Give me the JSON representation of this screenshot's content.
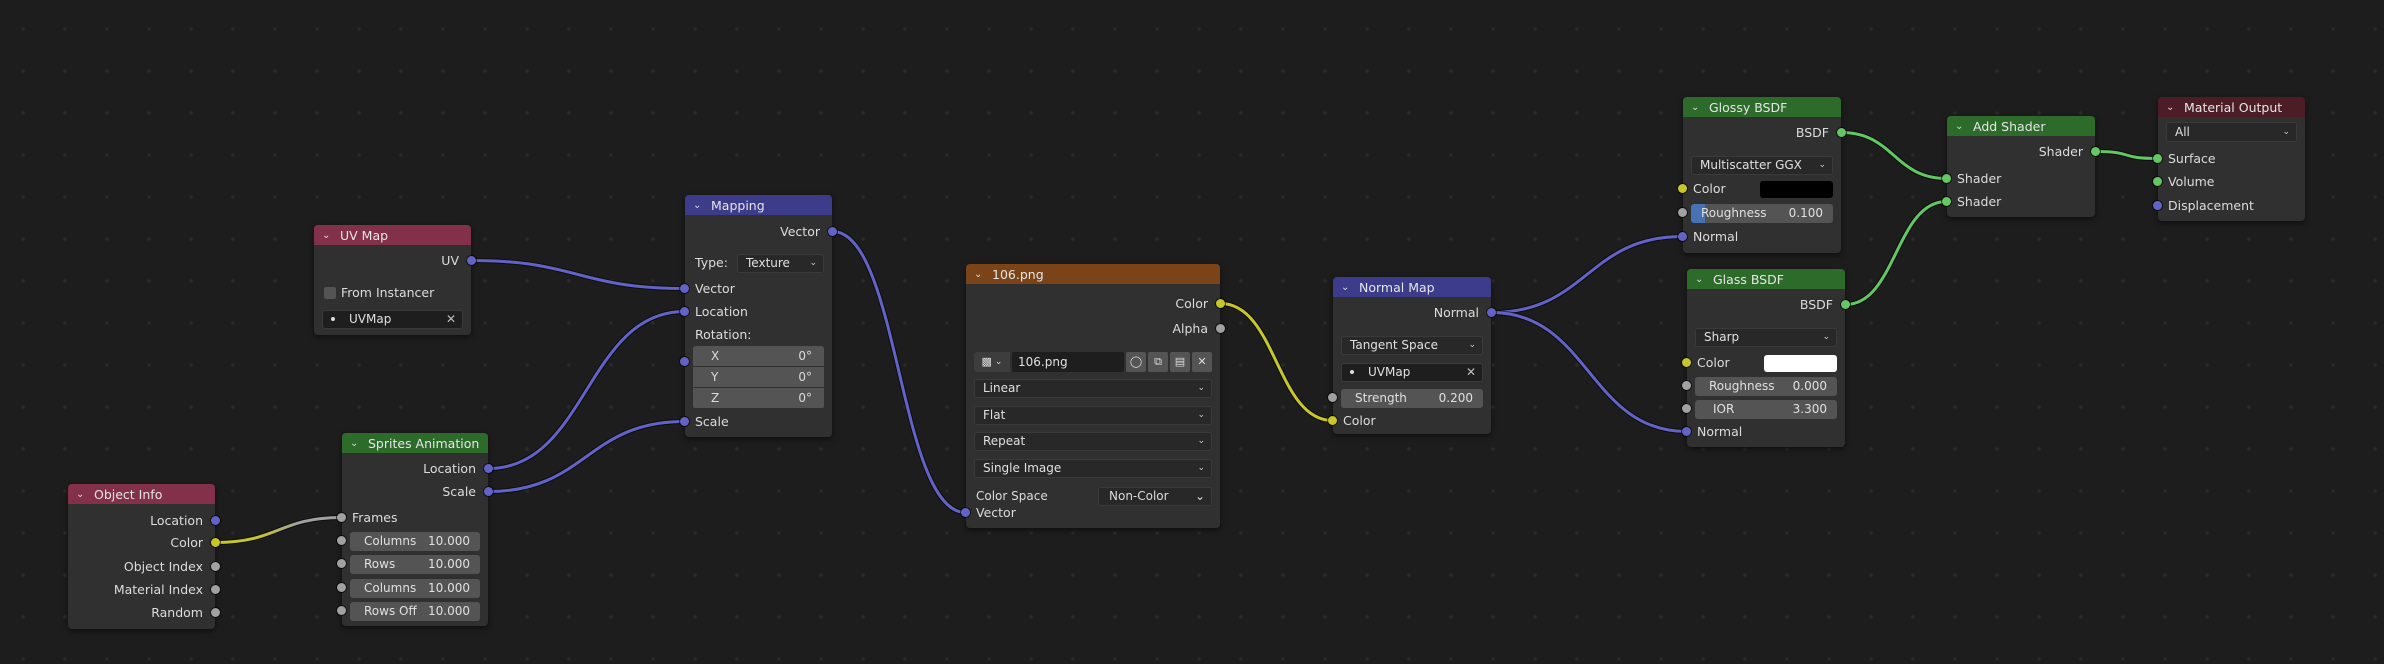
{
  "editor": {
    "type": "Shader Node Editor"
  },
  "colors": {
    "vector_socket": "#6363c7",
    "color_socket": "#c7c729",
    "value_socket": "#a1a1a1",
    "shader_socket": "#63c763",
    "slider_fill": "#4772b3"
  },
  "nodes": {
    "object_info": {
      "title": "Object Info",
      "outputs": [
        "Location",
        "Color",
        "Object Index",
        "Material Index",
        "Random"
      ]
    },
    "sprites_animation": {
      "title": "Sprites Animation",
      "outputs": [
        "Location",
        "Scale"
      ],
      "inputs": [
        {
          "label": "Frames"
        },
        {
          "label": "Columns",
          "value": "10.000"
        },
        {
          "label": "Rows",
          "value": "10.000"
        },
        {
          "label": "Columns",
          "value": "10.000"
        },
        {
          "label": "Rows Off",
          "value": "10.000"
        }
      ]
    },
    "uv_map": {
      "title": "UV Map",
      "outputs": [
        "UV"
      ],
      "from_instancer_label": "From Instancer",
      "from_instancer_checked": false,
      "uv_map_value": "UVMap"
    },
    "mapping": {
      "title": "Mapping",
      "outputs": [
        "Vector"
      ],
      "type_label": "Type:",
      "type_value": "Texture",
      "inputs": [
        "Vector",
        "Location"
      ],
      "rotation_label": "Rotation:",
      "rotation": [
        {
          "axis": "X",
          "value": "0°"
        },
        {
          "axis": "Y",
          "value": "0°"
        },
        {
          "axis": "Z",
          "value": "0°"
        }
      ],
      "scale_label": "Scale"
    },
    "image_texture": {
      "title": "106.png",
      "outputs": [
        "Color",
        "Alpha"
      ],
      "image_name": "106.png",
      "interpolation": "Linear",
      "projection": "Flat",
      "extension": "Repeat",
      "source": "Single Image",
      "color_space_label": "Color Space",
      "color_space_value": "Non-Color",
      "inputs": [
        "Vector"
      ]
    },
    "normal_map": {
      "title": "Normal Map",
      "outputs": [
        "Normal"
      ],
      "space": "Tangent Space",
      "uv_map_value": "UVMap",
      "strength_label": "Strength",
      "strength_value": "0.200",
      "inputs": [
        "Color"
      ]
    },
    "glossy_bsdf": {
      "title": "Glossy BSDF",
      "outputs": [
        "BSDF"
      ],
      "distribution": "Multiscatter GGX",
      "color_label": "Color",
      "color_value": "#000000",
      "roughness_label": "Roughness",
      "roughness_value": "0.100",
      "roughness_fraction": 0.1,
      "normal_label": "Normal"
    },
    "glass_bsdf": {
      "title": "Glass BSDF",
      "outputs": [
        "BSDF"
      ],
      "distribution": "Sharp",
      "color_label": "Color",
      "color_value": "#ffffff",
      "roughness_label": "Roughness",
      "roughness_value": "0.000",
      "ior_label": "IOR",
      "ior_value": "3.300",
      "normal_label": "Normal"
    },
    "add_shader": {
      "title": "Add Shader",
      "outputs": [
        "Shader"
      ],
      "inputs": [
        "Shader",
        "Shader"
      ]
    },
    "material_output": {
      "title": "Material Output",
      "target": "All",
      "inputs": [
        "Surface",
        "Volume",
        "Displacement"
      ]
    }
  },
  "links": [
    {
      "from": "objinfo-out-color",
      "to": "sprites-in-frames",
      "from_color": "#c7c729",
      "to_color": "#a1a1a1"
    },
    {
      "from": "sprites-out-location",
      "to": "mapping-in-location",
      "from_color": "#6363c7",
      "to_color": "#6363c7"
    },
    {
      "from": "sprites-out-scale",
      "to": "mapping-in-scale",
      "from_color": "#6363c7",
      "to_color": "#6363c7"
    },
    {
      "from": "uvmap-out-uv",
      "to": "mapping-in-vector",
      "from_color": "#6363c7",
      "to_color": "#6363c7"
    },
    {
      "from": "mapping-out-vector",
      "to": "image-in-vector",
      "from_color": "#6363c7",
      "to_color": "#6363c7"
    },
    {
      "from": "image-out-color",
      "to": "normalmap-in-color",
      "from_color": "#c7c729",
      "to_color": "#c7c729"
    },
    {
      "from": "normalmap-out-normal",
      "to": "glossy-in-normal",
      "from_color": "#6363c7",
      "to_color": "#6363c7"
    },
    {
      "from": "normalmap-out-normal",
      "to": "glass-in-normal",
      "from_color": "#6363c7",
      "to_color": "#6363c7"
    },
    {
      "from": "glossy-out-bsdf",
      "to": "add-in-shader1",
      "from_color": "#63c763",
      "to_color": "#63c763"
    },
    {
      "from": "glass-out-bsdf",
      "to": "add-in-shader2",
      "from_color": "#63c763",
      "to_color": "#63c763"
    },
    {
      "from": "add-out-shader",
      "to": "matout-in-surface",
      "from_color": "#63c763",
      "to_color": "#63c763"
    }
  ]
}
